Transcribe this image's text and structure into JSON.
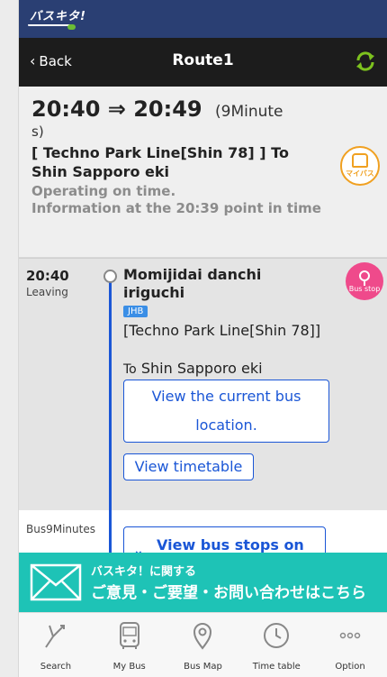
{
  "brand": {
    "logo_text": "バスキタ!"
  },
  "nav": {
    "back_label": "Back",
    "title": "Route1"
  },
  "summary": {
    "depart": "20:40",
    "arrow": "⇒",
    "arrive": "20:49",
    "duration_head": "(9Minute",
    "duration_tail": "s)",
    "line_name": "[ Techno Park Line[Shin 78] ] To Shin Sapporo eki",
    "status": "Operating on time.",
    "info": "Information at the 20:39 point in time",
    "mybus_label": "マイバス"
  },
  "stop": {
    "time": "20:40",
    "leaving": "Leaving",
    "name": "Momijidai danchi iriguchi",
    "badge": "JHB",
    "line": "[Techno Park Line[Shin 78]]",
    "to_prefix": "To",
    "destination": "Shin Sapporo eki",
    "stop_icon_label": "Bus stop",
    "location_button": "View the current bus location.",
    "timetable_button": "View timetable"
  },
  "bus_segment": {
    "duration": "Bus9Minutes",
    "stops_button": "View bus stops on"
  },
  "banner": {
    "line1": "バスキタ！に関する",
    "line2": "ご意見・ご要望・お問い合わせはこちら"
  },
  "tabs": [
    {
      "label": "Search",
      "icon": "search-route-icon"
    },
    {
      "label": "My Bus",
      "icon": "my-bus-icon"
    },
    {
      "label": "Bus Map",
      "icon": "map-pin-icon"
    },
    {
      "label": "Time table",
      "icon": "clock-icon"
    },
    {
      "label": "Option",
      "icon": "more-icon"
    }
  ],
  "colors": {
    "brand_bar": "#2a3f73",
    "nav_bar": "#1c1c1c",
    "accent_blue": "#1a56d6",
    "stop_pink": "#ef4a8b",
    "mybus_orange": "#f0a020",
    "banner_teal": "#1ec3b6",
    "refresh_green": "#7dc21e"
  }
}
